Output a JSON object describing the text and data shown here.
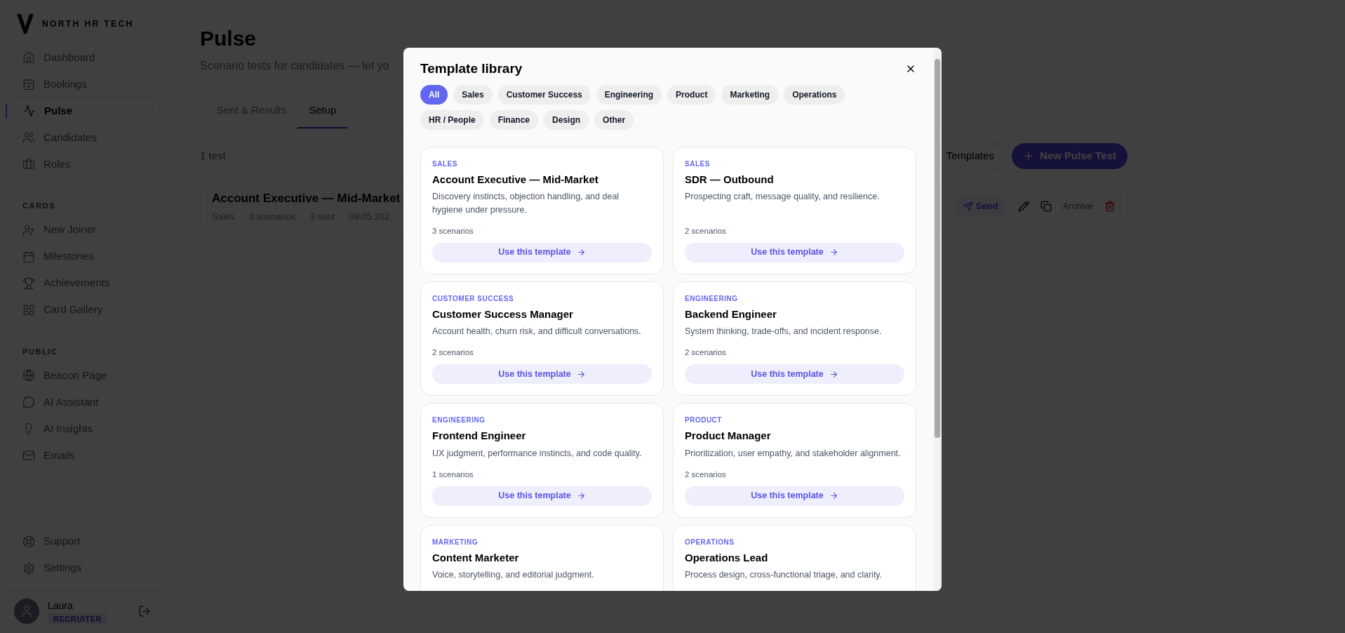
{
  "brand": {
    "name": "NORTH HR TECH"
  },
  "sidebar": {
    "main_items": [
      {
        "label": "Dashboard",
        "selected": false
      },
      {
        "label": "Bookings",
        "selected": false
      },
      {
        "label": "Pulse",
        "selected": true
      },
      {
        "label": "Candidates",
        "selected": false
      },
      {
        "label": "Roles",
        "selected": false
      }
    ],
    "sections": [
      {
        "title": "CARDS",
        "items": [
          {
            "label": "New Joiner",
            "selected": false
          },
          {
            "label": "Milestones",
            "selected": false
          },
          {
            "label": "Achievements",
            "selected": false
          },
          {
            "label": "Card Gallery",
            "selected": false
          }
        ]
      },
      {
        "title": "PUBLIC",
        "items": [
          {
            "label": "Beacon Page",
            "selected": false
          },
          {
            "label": "AI Assistant",
            "selected": false
          },
          {
            "label": "AI Insights",
            "selected": false
          },
          {
            "label": "Emails",
            "selected": false
          }
        ]
      }
    ],
    "bottom_items": [
      {
        "label": "Support",
        "selected": false
      },
      {
        "label": "Settings",
        "selected": false
      }
    ],
    "user": {
      "name": "Laura",
      "role": "RECRUITER"
    }
  },
  "page": {
    "title": "Pulse",
    "subtitle": "Scenario tests for candidates — let yo",
    "tabs": [
      {
        "label": "Sent & Results",
        "selected": false
      },
      {
        "label": "Setup",
        "selected": true
      }
    ],
    "count": "1 test",
    "templates_button": "Templates",
    "new_button": "New Pulse Test",
    "tests": [
      {
        "title": "Account Executive — Mid-Market",
        "separator": "·",
        "meta": [
          "Sales",
          "3 scenarios",
          "3 sent",
          "09.05.202"
        ],
        "send": "Send",
        "archive": "Archive"
      }
    ]
  },
  "modal": {
    "title": "Template library",
    "filters": [
      {
        "label": "All",
        "selected": true
      },
      {
        "label": "Sales",
        "selected": false
      },
      {
        "label": "Customer Success",
        "selected": false
      },
      {
        "label": "Engineering",
        "selected": false
      },
      {
        "label": "Product",
        "selected": false
      },
      {
        "label": "Marketing",
        "selected": false
      },
      {
        "label": "Operations",
        "selected": false
      },
      {
        "label": "HR / People",
        "selected": false
      },
      {
        "label": "Finance",
        "selected": false
      },
      {
        "label": "Design",
        "selected": false
      },
      {
        "label": "Other",
        "selected": false
      }
    ],
    "templates": [
      {
        "category": "SALES",
        "title": "Account Executive — Mid-Market",
        "description": "Discovery instincts, objection handling, and deal hygiene under pressure.",
        "scenarios": "3 scenarios",
        "button": "Use this template"
      },
      {
        "category": "SALES",
        "title": "SDR — Outbound",
        "description": "Prospecting craft, message quality, and resilience.",
        "scenarios": "2 scenarios",
        "button": "Use this template"
      },
      {
        "category": "CUSTOMER SUCCESS",
        "title": "Customer Success Manager",
        "description": "Account health, churn risk, and difficult conversations.",
        "scenarios": "2 scenarios",
        "button": "Use this template"
      },
      {
        "category": "ENGINEERING",
        "title": "Backend Engineer",
        "description": "System thinking, trade-offs, and incident response.",
        "scenarios": "2 scenarios",
        "button": "Use this template"
      },
      {
        "category": "ENGINEERING",
        "title": "Frontend Engineer",
        "description": "UX judgment, performance instincts, and code quality.",
        "scenarios": "1 scenarios",
        "button": "Use this template"
      },
      {
        "category": "PRODUCT",
        "title": "Product Manager",
        "description": "Prioritization, user empathy, and stakeholder alignment.",
        "scenarios": "2 scenarios",
        "button": "Use this template"
      },
      {
        "category": "MARKETING",
        "title": "Content Marketer",
        "description": "Voice, storytelling, and editorial judgment."
      },
      {
        "category": "OPERATIONS",
        "title": "Operations Lead",
        "description": "Process design, cross-functional triage, and clarity."
      }
    ]
  }
}
